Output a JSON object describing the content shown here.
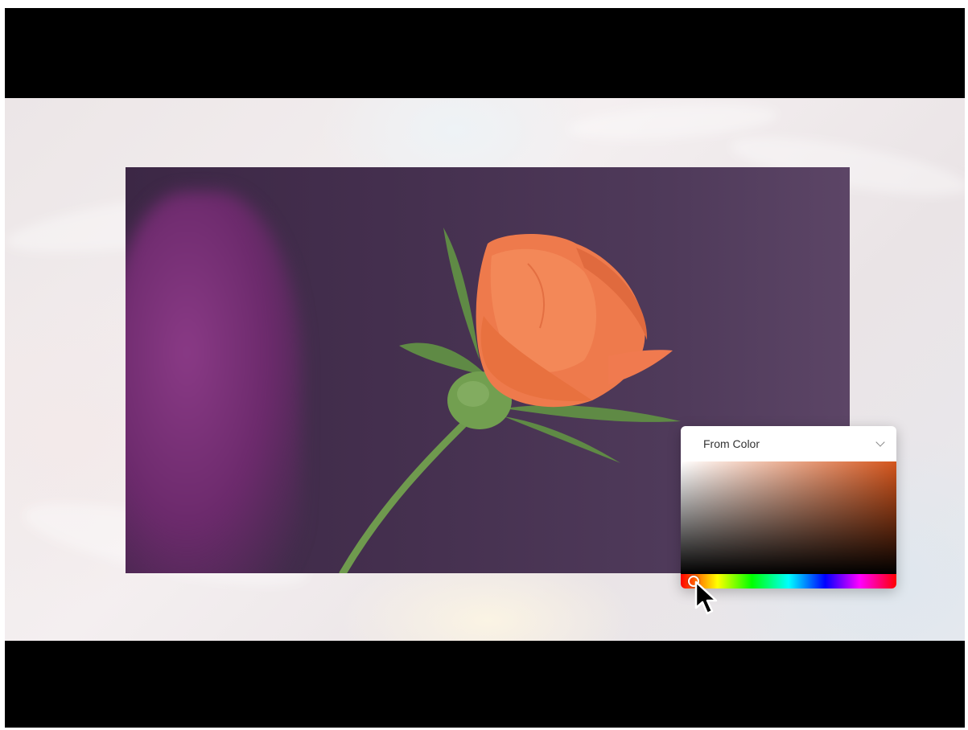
{
  "picker": {
    "dropdown_label": "From Color",
    "dropdown_icon": "chevron-down-icon",
    "base_hue_color": "#d4551c",
    "hue_value": 0.02
  },
  "colors": {
    "photo_background": "#45304f",
    "rose_petal": "#f07a4f",
    "stem": "#6f9a4e"
  },
  "cursor_icon": "arrow-cursor-icon"
}
